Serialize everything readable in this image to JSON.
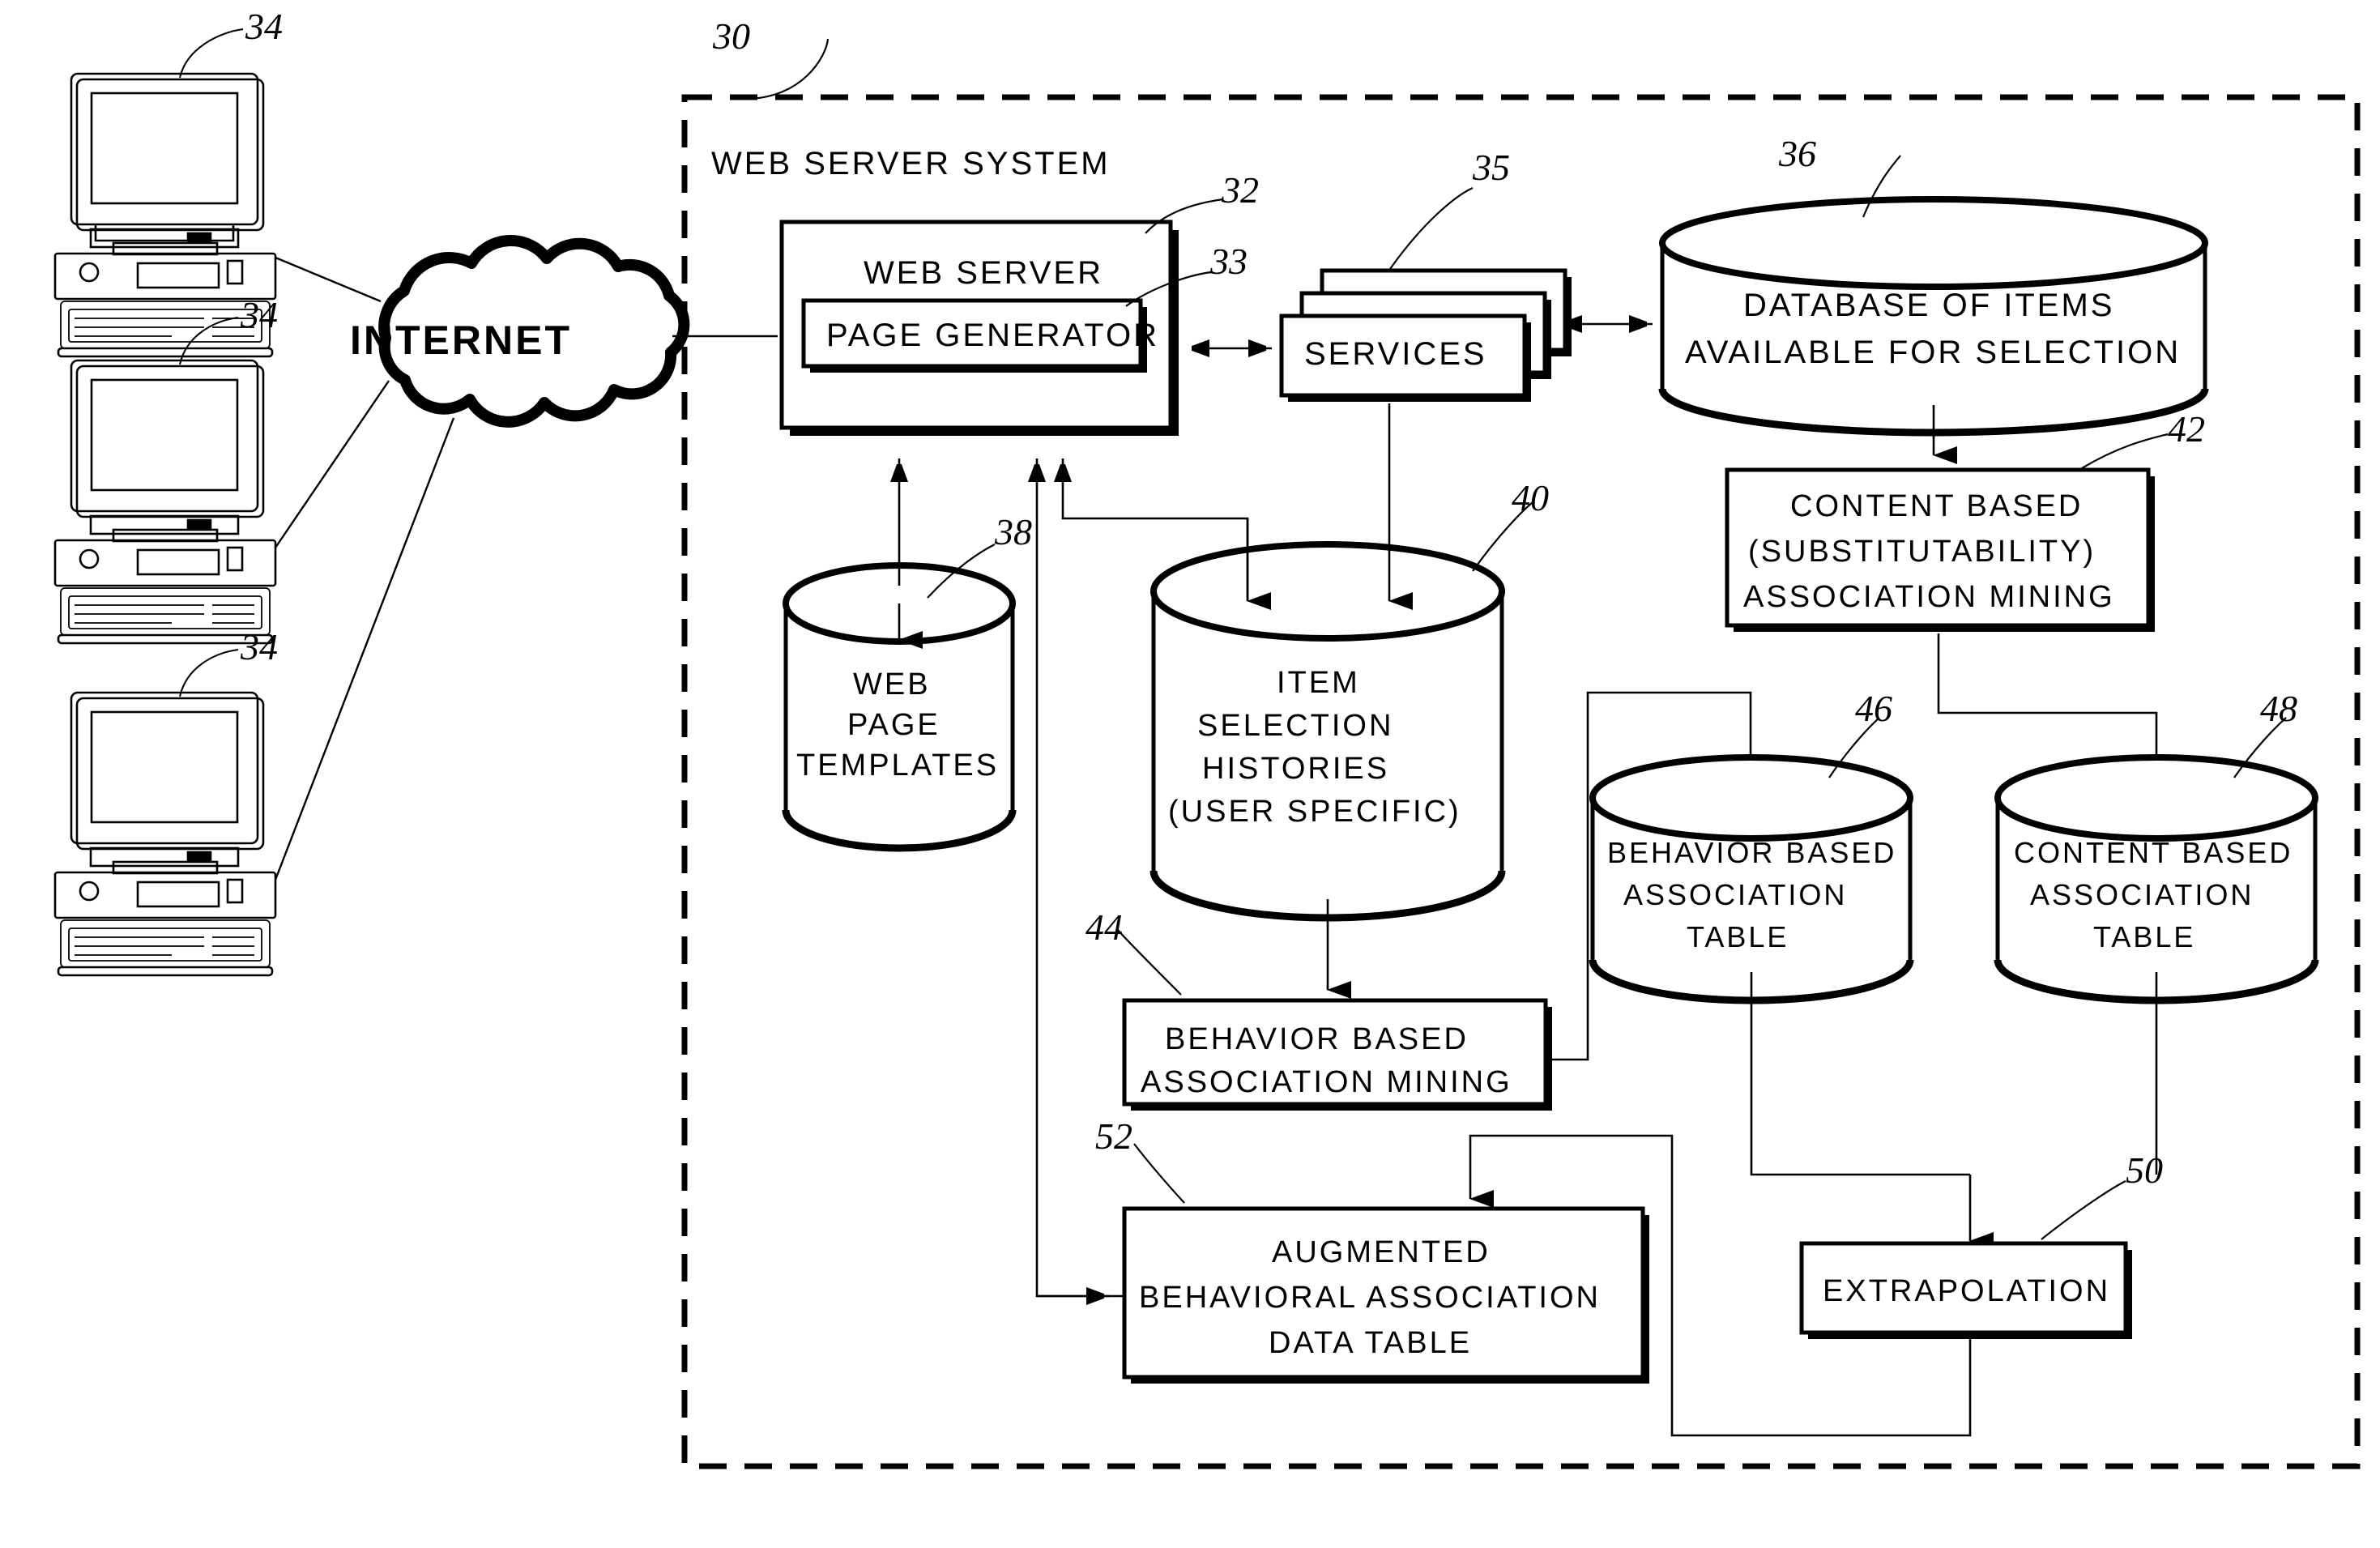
{
  "figure": {
    "title": "Web server system architecture block diagram",
    "system_label": "WEB SERVER SYSTEM",
    "system_ref": "30"
  },
  "clients": {
    "ref": "34",
    "count": 3,
    "icon": "desktop-computer-icon",
    "refs": [
      "34",
      "34",
      "34"
    ]
  },
  "network": {
    "label": "INTERNET",
    "icon": "cloud-icon"
  },
  "nodes": [
    {
      "id": "web_server",
      "label": "WEB SERVER",
      "ref": "32",
      "shape": "box"
    },
    {
      "id": "page_generator",
      "label": "PAGE GENERATOR",
      "ref": "33",
      "shape": "box"
    },
    {
      "id": "services",
      "label": "SERVICES",
      "ref": "35",
      "shape": "stacked-box"
    },
    {
      "id": "item_db",
      "label": "DATABASE OF ITEMS\nAVAILABLE FOR SELECTION",
      "ref": "36",
      "shape": "cylinder"
    },
    {
      "id": "templates",
      "label": "WEB\nPAGE\nTEMPLATES",
      "ref": "38",
      "shape": "cylinder"
    },
    {
      "id": "histories",
      "label": "ITEM\nSELECTION\nHISTORIES\n(USER SPECIFIC)",
      "ref": "40",
      "shape": "cylinder"
    },
    {
      "id": "content_mining",
      "label": "CONTENT BASED\n(SUBSTITUTABILITY)\nASSOCIATION MINING",
      "ref": "42",
      "shape": "box"
    },
    {
      "id": "behavior_mining",
      "label": "BEHAVIOR BASED\nASSOCIATION MINING",
      "ref": "44",
      "shape": "box"
    },
    {
      "id": "behavior_table",
      "label": "BEHAVIOR BASED\nASSOCIATION\nTABLE",
      "ref": "46",
      "shape": "cylinder"
    },
    {
      "id": "content_table",
      "label": "CONTENT BASED\nASSOCIATION\nTABLE",
      "ref": "48",
      "shape": "cylinder"
    },
    {
      "id": "extrapolation",
      "label": "EXTRAPOLATION",
      "ref": "50",
      "shape": "box"
    },
    {
      "id": "augmented_table",
      "label": "AUGMENTED\nBEHAVIORAL ASSOCIATION\nDATA TABLE",
      "ref": "52",
      "shape": "box"
    }
  ],
  "labels": {
    "web_server": "WEB SERVER",
    "page_generator": "PAGE GENERATOR",
    "services": "SERVICES",
    "item_db_line1": "DATABASE OF ITEMS",
    "item_db_line2": "AVAILABLE FOR SELECTION",
    "templates_line1": "WEB",
    "templates_line2": "PAGE",
    "templates_line3": "TEMPLATES",
    "histories_line1": "ITEM",
    "histories_line2": "SELECTION",
    "histories_line3": "HISTORIES",
    "histories_line4": "(USER SPECIFIC)",
    "content_mining_line1": "CONTENT BASED",
    "content_mining_line2": "(SUBSTITUTABILITY)",
    "content_mining_line3": "ASSOCIATION MINING",
    "behavior_mining_line1": "BEHAVIOR BASED",
    "behavior_mining_line2": "ASSOCIATION MINING",
    "behavior_table_line1": "BEHAVIOR BASED",
    "behavior_table_line2": "ASSOCIATION",
    "behavior_table_line3": "TABLE",
    "content_table_line1": "CONTENT BASED",
    "content_table_line2": "ASSOCIATION",
    "content_table_line3": "TABLE",
    "extrapolation": "EXTRAPOLATION",
    "augmented_line1": "AUGMENTED",
    "augmented_line2": "BEHAVIORAL ASSOCIATION",
    "augmented_line3": "DATA TABLE",
    "system": "WEB SERVER SYSTEM",
    "internet": "INTERNET"
  },
  "refnums": {
    "n30": "30",
    "n32": "32",
    "n33": "33",
    "n34a": "34",
    "n34b": "34",
    "n34c": "34",
    "n35": "35",
    "n36": "36",
    "n38": "38",
    "n40": "40",
    "n42": "42",
    "n44": "44",
    "n46": "46",
    "n48": "48",
    "n50": "50",
    "n52": "52"
  },
  "colors": {
    "ink": "#000000",
    "paper": "#ffffff"
  }
}
